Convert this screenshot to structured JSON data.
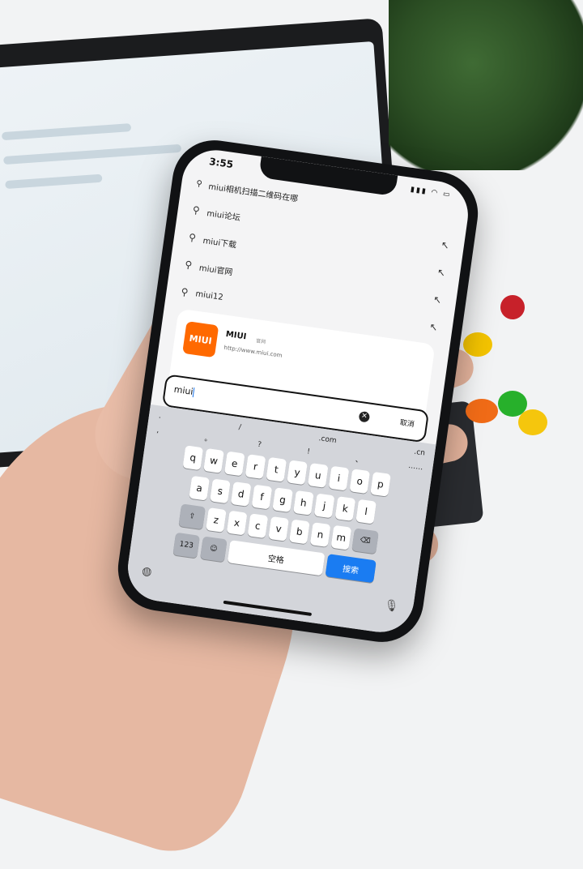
{
  "status": {
    "time": "3:55"
  },
  "top_query": "miui相机扫描二维码在哪",
  "suggestions": [
    {
      "text": "miui论坛"
    },
    {
      "text": "miui下载"
    },
    {
      "text": "miui官网"
    },
    {
      "text": "miui12"
    }
  ],
  "result_card": {
    "logo_text": "MIUI",
    "title": "MIUI",
    "badge": "官网",
    "url": "http://www.miui.com"
  },
  "search": {
    "value": "miui",
    "cancel_label": "取消"
  },
  "keyboard": {
    "predictions": [
      ".",
      "/",
      ".com",
      ".cn"
    ],
    "symbols": [
      ",",
      "。",
      "?",
      "!",
      "、",
      "……"
    ],
    "row1": [
      "q",
      "w",
      "e",
      "r",
      "t",
      "y",
      "u",
      "i",
      "o",
      "p"
    ],
    "row2": [
      "a",
      "s",
      "d",
      "f",
      "g",
      "h",
      "j",
      "k",
      "l"
    ],
    "row3": [
      "z",
      "x",
      "c",
      "v",
      "b",
      "n",
      "m"
    ],
    "num_label": "123",
    "space_label": "空格",
    "go_label": "搜索"
  },
  "colors": {
    "miui_orange": "#ff6900",
    "key_blue": "#1a7cf2"
  }
}
